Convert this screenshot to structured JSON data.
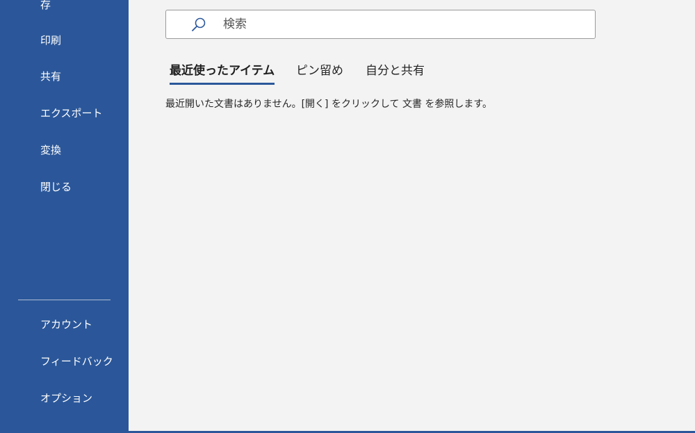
{
  "sidebar": {
    "items": [
      {
        "label": "存"
      },
      {
        "label": "印刷"
      },
      {
        "label": "共有"
      },
      {
        "label": "エクスポート"
      },
      {
        "label": "変換"
      },
      {
        "label": "閉じる"
      }
    ],
    "bottom_items": [
      {
        "label": "アカウント"
      },
      {
        "label": "フィードバック"
      },
      {
        "label": "オプション"
      }
    ]
  },
  "search": {
    "placeholder": "検索",
    "value": "",
    "icon": "search-icon"
  },
  "tabs": [
    {
      "label": "最近使ったアイテム",
      "active": true
    },
    {
      "label": "ピン留め",
      "active": false
    },
    {
      "label": "自分と共有",
      "active": false
    }
  ],
  "empty_message": "最近開いた文書はありません。[開く] をクリックして 文書 を参照します。",
  "colors": {
    "sidebar_bg": "#2b579a",
    "main_bg": "#f3f3f3",
    "accent": "#2b579a"
  }
}
